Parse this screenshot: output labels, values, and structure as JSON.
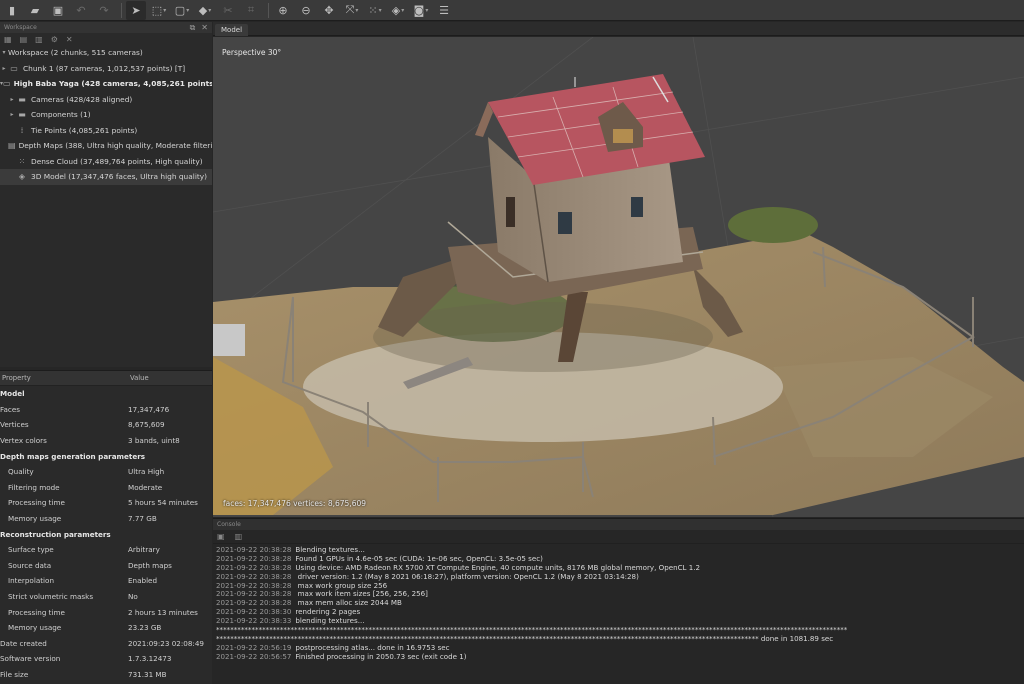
{
  "toolbar": {
    "icons": [
      "new-file-icon",
      "open-folder-icon",
      "save-icon",
      "undo-icon",
      "redo-icon",
      "pointer-icon",
      "rectangle-select-icon",
      "crop-icon",
      "paint-select-icon",
      "cut-icon",
      "crop-region-icon",
      "zoom-in-icon",
      "zoom-out-icon",
      "move-object-icon",
      "navigation-icon",
      "grid-icon",
      "shading-icon",
      "camera-icon",
      "layers-icon"
    ]
  },
  "workspace": {
    "header": "Workspace",
    "items": [
      {
        "label": "Workspace (2 chunks, 515 cameras)",
        "level": 0,
        "bold": false
      },
      {
        "label": "Chunk 1 (87 cameras, 1,012,537 points) [T]",
        "level": 0,
        "bold": false
      },
      {
        "label": "High Baba Yaga (428 cameras, 4,085,261 points) [T]",
        "level": 0,
        "bold": true
      },
      {
        "label": "Cameras (428/428 aligned)",
        "level": 1,
        "bold": false
      },
      {
        "label": "Components (1)",
        "level": 1,
        "bold": false
      },
      {
        "label": "Tie Points (4,085,261 points)",
        "level": 1,
        "bold": false
      },
      {
        "label": "Depth Maps (388, Ultra high quality, Moderate filtering)",
        "level": 1,
        "bold": false
      },
      {
        "label": "Dense Cloud (37,489,764 points, High quality)",
        "level": 1,
        "bold": false
      },
      {
        "label": "3D Model (17,347,476 faces, Ultra high quality)",
        "level": 1,
        "bold": false
      }
    ]
  },
  "properties": {
    "col_property": "Property",
    "col_value": "Value",
    "rows": [
      {
        "key": "Model",
        "value": "",
        "type": "section"
      },
      {
        "key": "Faces",
        "value": "17,347,476",
        "type": "top"
      },
      {
        "key": "Vertices",
        "value": "8,675,609",
        "type": "top"
      },
      {
        "key": "Vertex colors",
        "value": "3 bands, uint8",
        "type": "top"
      },
      {
        "key": "Depth maps generation parameters",
        "value": "",
        "type": "section"
      },
      {
        "key": "Quality",
        "value": "Ultra High",
        "type": "sub"
      },
      {
        "key": "Filtering mode",
        "value": "Moderate",
        "type": "sub"
      },
      {
        "key": "Processing time",
        "value": "5 hours 54 minutes",
        "type": "sub"
      },
      {
        "key": "Memory usage",
        "value": "7.77 GB",
        "type": "sub"
      },
      {
        "key": "Reconstruction parameters",
        "value": "",
        "type": "section"
      },
      {
        "key": "Surface type",
        "value": "Arbitrary",
        "type": "sub"
      },
      {
        "key": "Source data",
        "value": "Depth maps",
        "type": "sub"
      },
      {
        "key": "Interpolation",
        "value": "Enabled",
        "type": "sub"
      },
      {
        "key": "Strict volumetric masks",
        "value": "No",
        "type": "sub"
      },
      {
        "key": "Processing time",
        "value": "2 hours 13 minutes",
        "type": "sub"
      },
      {
        "key": "Memory usage",
        "value": "23.23 GB",
        "type": "sub"
      },
      {
        "key": "Date created",
        "value": "2021:09:23 02:08:49",
        "type": "top"
      },
      {
        "key": "Software version",
        "value": "1.7.3.12473",
        "type": "top"
      },
      {
        "key": "File size",
        "value": "731.31 MB",
        "type": "top"
      }
    ]
  },
  "model_view": {
    "tab_label": "Model",
    "view_label": "Perspective 30°",
    "stats": "faces: 17,347,476 vertices: 8,675,609"
  },
  "console": {
    "header": "Console",
    "lines": [
      {
        "ts": "2021-09-22 20:38:28",
        "text": "Blending textures..."
      },
      {
        "ts": "2021-09-22 20:38:28",
        "text": "Found 1 GPUs in 4.6e-05 sec (CUDA: 1e-06 sec, OpenCL: 3.5e-05 sec)"
      },
      {
        "ts": "2021-09-22 20:38:28",
        "text": "Using device: AMD Radeon RX 5700 XT Compute Engine, 40 compute units, 8176 MB global memory, OpenCL 1.2"
      },
      {
        "ts": "2021-09-22 20:38:28",
        "text": "  driver version: 1.2 (May  8 2021 06:18:27), platform version: OpenCL 1.2 (May  8 2021 03:14:28)"
      },
      {
        "ts": "2021-09-22 20:38:28",
        "text": "  max work group size 256"
      },
      {
        "ts": "2021-09-22 20:38:28",
        "text": "  max work item sizes [256, 256, 256]"
      },
      {
        "ts": "2021-09-22 20:38:28",
        "text": "  max mem alloc size 2044 MB"
      },
      {
        "ts": "2021-09-22 20:38:30",
        "text": "rendering 2 pages"
      },
      {
        "ts": "2021-09-22 20:38:33",
        "text": "blending textures..."
      },
      {
        "ts": "",
        "text": "**********************************************************************************************************************************************************************************"
      },
      {
        "ts": "",
        "text": "********************************************************************************************************************************************************* done in 1081.89 sec"
      },
      {
        "ts": "2021-09-22 20:56:19",
        "text": "postprocessing atlas... done in 16.9753 sec"
      },
      {
        "ts": "2021-09-22 20:56:57",
        "text": "Finished processing in 2050.73 sec (exit code 1)"
      }
    ]
  }
}
